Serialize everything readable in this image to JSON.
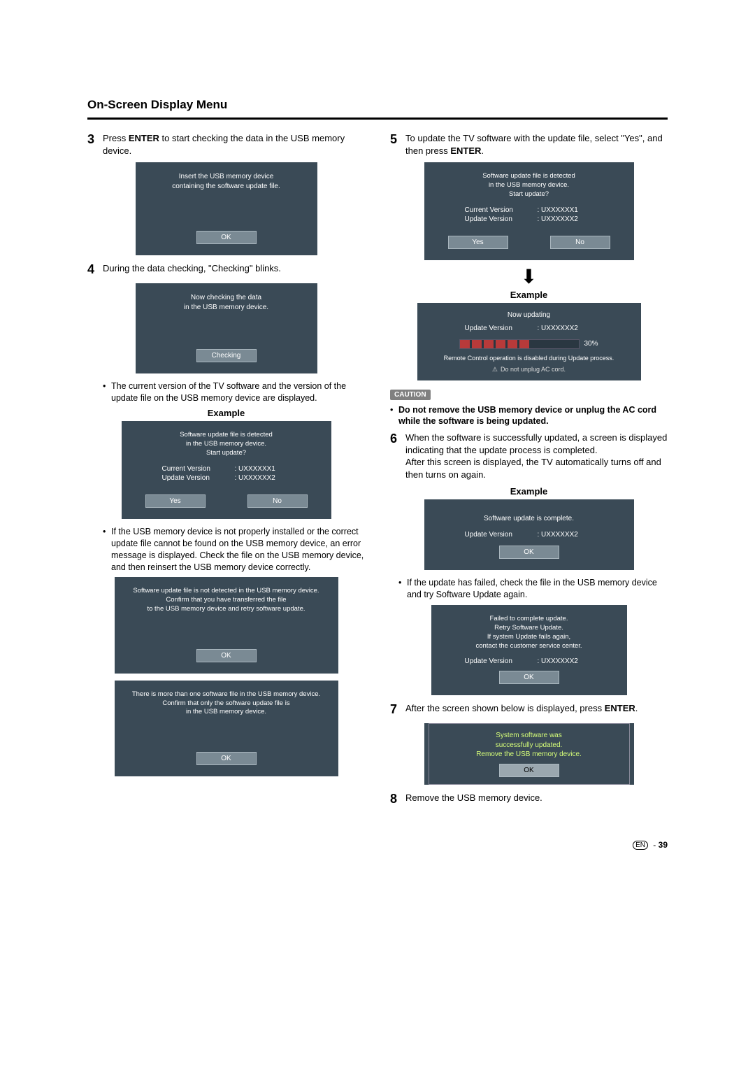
{
  "title": "On-Screen Display Menu",
  "left": {
    "step3": {
      "num": "3",
      "text_before": "Press ",
      "bold": "ENTER",
      "text_after": " to start checking the data in the USB memory device."
    },
    "dialog_insert": {
      "line1": "Insert the USB memory device",
      "line2": "containing the software update file.",
      "ok": "OK"
    },
    "step4": {
      "num": "4",
      "text": "During the data checking, \"Checking\" blinks."
    },
    "dialog_checking": {
      "line1": "Now checking the data",
      "line2": "in the USB memory device.",
      "btn": "Checking"
    },
    "bullet_current": "The current version of the TV software and the version of the update file on the USB memory device are displayed.",
    "example_label": "Example",
    "dialog_detected": {
      "line1": "Software update file is detected",
      "line2": "in the USB memory device.",
      "line3": "Start update?",
      "cur_lbl": "Current Version",
      "cur_val": ":  UXXXXXX1",
      "upd_lbl": "Update Version",
      "upd_val": ":  UXXXXXX2",
      "yes": "Yes",
      "no": "No"
    },
    "bullet_notinstalled": "If the USB memory device is not properly installed or the correct update file cannot be found on the USB memory device, an error message is displayed. Check the file on the USB memory device, and then reinsert the USB memory device correctly.",
    "dialog_notdetected": {
      "line1": "Software update file is not detected in the USB memory device.",
      "line2": "Confirm that you have transferred the file",
      "line3": "to the USB memory device and retry software update.",
      "ok": "OK"
    },
    "dialog_multifile": {
      "line1": "There is more than one software file in the USB memory device.",
      "line2": "Confirm that only the software update file is",
      "line3": "in the USB memory device.",
      "ok": "OK"
    }
  },
  "right": {
    "step5": {
      "num": "5",
      "text_before": "To update the TV software with the update file, select \"Yes\", and then press ",
      "bold": "ENTER",
      "text_after": "."
    },
    "dialog_detected2": {
      "line1": "Software update file is detected",
      "line2": "in the USB memory device.",
      "line3": "Start update?",
      "cur_lbl": "Current Version",
      "cur_val": ":  UXXXXXX1",
      "upd_lbl": "Update Version",
      "upd_val": ":  UXXXXXX2",
      "yes": "Yes",
      "no": "No"
    },
    "example_label": "Example",
    "dialog_updating": {
      "title": "Now updating",
      "upd_lbl": "Update Version",
      "upd_val": ":  UXXXXXX2",
      "pct": "30%",
      "remote": "Remote Control operation is disabled during Update process.",
      "unplug": "Do not unplug AC cord."
    },
    "caution_label": "CAUTION",
    "caution_text": "Do not remove the USB memory device or unplug the AC cord while the software is being updated.",
    "step6": {
      "num": "6",
      "text": "When the software is successfully updated, a screen is displayed indicating that the update process is completed.",
      "text2": "After this screen is displayed, the TV automatically turns off and then turns on again."
    },
    "dialog_complete": {
      "msg": "Software update is complete.",
      "upd_lbl": "Update Version",
      "upd_val": ":  UXXXXXX2",
      "ok": "OK"
    },
    "bullet_failed": "If the update has failed, check the file in the USB memory device and try Software Update again.",
    "dialog_failed": {
      "line1": "Failed to complete update.",
      "line2": "Retry Software Update.",
      "line3": "If system Update fails again,",
      "line4": "contact the customer service center.",
      "upd_lbl": "Update Version",
      "upd_val": ":  UXXXXXX2",
      "ok": "OK"
    },
    "step7": {
      "num": "7",
      "text_before": "After the screen shown below is displayed, press ",
      "bold": "ENTER",
      "text_after": "."
    },
    "dialog_success": {
      "line1": "System software was",
      "line2": "successfully updated.",
      "line3": "Remove the USB memory device.",
      "ok": "OK"
    },
    "step8": {
      "num": "8",
      "text": "Remove the USB memory device."
    }
  },
  "page_num": "39",
  "page_lang": "EN",
  "dash": " - "
}
